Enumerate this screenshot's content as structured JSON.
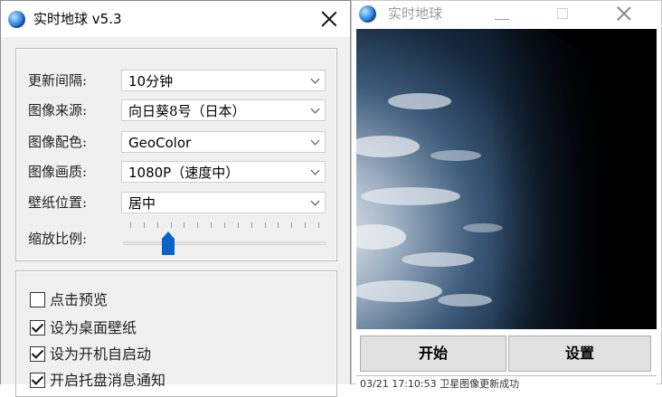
{
  "settings_window": {
    "title": "实时地球 v5.3",
    "fields": [
      {
        "label": "更新间隔:",
        "value": "10分钟"
      },
      {
        "label": "图像来源:",
        "value": "向日葵8号（日本）"
      },
      {
        "label": "图像配色:",
        "value": "GeoColor"
      },
      {
        "label": "图像画质:",
        "value": "1080P（速度中）"
      },
      {
        "label": "壁纸位置:",
        "value": "居中"
      }
    ],
    "zoom": {
      "label": "缩放比例:",
      "tick_count": 15,
      "level_fraction": 0.2
    },
    "options": [
      {
        "label": "点击预览",
        "checked": false
      },
      {
        "label": "设为桌面壁纸",
        "checked": true
      },
      {
        "label": "设为开机自启动",
        "checked": true
      },
      {
        "label": "开启托盘消息通知",
        "checked": true
      }
    ]
  },
  "preview_window": {
    "title": "实时地球",
    "start_button": "开始",
    "settings_button": "设置",
    "status": "03/21 17:10:53 卫星图像更新成功"
  },
  "icons": {
    "app": "earth-icon",
    "close": "close-icon",
    "minimize": "minimize-icon",
    "maximize": "maximize-icon",
    "dropdown": "chevron-down-icon"
  },
  "colors": {
    "window_bg": "#f0f0f0",
    "slider_thumb": "#0a64c8",
    "earth_bg": "#000000"
  }
}
